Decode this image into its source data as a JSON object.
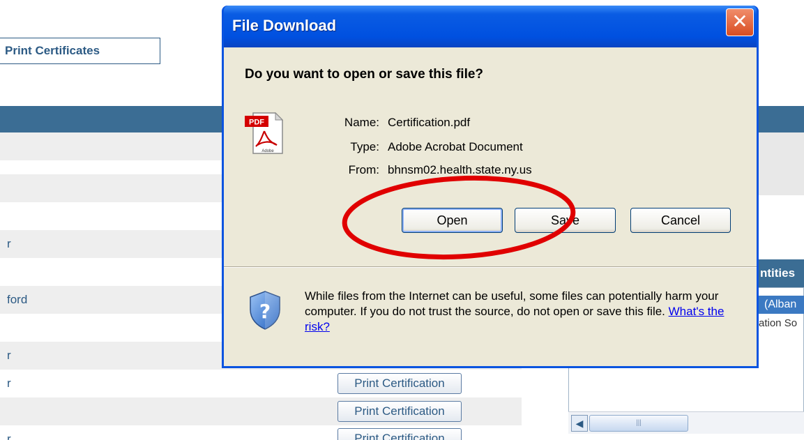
{
  "background": {
    "print_certificates_label": "Print Certificates",
    "rows": [
      {
        "text": ""
      },
      {
        "text": ""
      },
      {
        "text": ""
      },
      {
        "text": ""
      },
      {
        "text": "r"
      },
      {
        "text": ""
      },
      {
        "text": "ford"
      },
      {
        "text": ""
      },
      {
        "text": "r"
      },
      {
        "text": "r"
      },
      {
        "text": ""
      },
      {
        "text": "r"
      }
    ],
    "print_certification_label": "Print Certification",
    "right_panel": {
      "title": "ntities",
      "selected_item": "(Alban",
      "sub_item": "ation So"
    }
  },
  "dialog": {
    "title": "File Download",
    "question": "Do you want to open or save this file?",
    "file_info": {
      "name_label": "Name:",
      "name_value": "Certification.pdf",
      "type_label": "Type:",
      "type_value": "Adobe Acrobat Document",
      "from_label": "From:",
      "from_value": "bhnsm02.health.state.ny.us"
    },
    "buttons": {
      "open": "Open",
      "save": "Save",
      "cancel": "Cancel"
    },
    "warning_text": "While files from the Internet can be useful, some files can potentially harm your computer. If you do not trust the source, do not open or save this file.",
    "risk_link": "What's the risk?",
    "close_glyph": "✕"
  },
  "icons": {
    "file": "pdf-file-icon",
    "security": "shield-question-icon"
  },
  "colors": {
    "titlebar": "#0a54e0",
    "dialog_face": "#ece9d8",
    "page_accent": "#3b6d94",
    "annotation": "#e00000"
  }
}
